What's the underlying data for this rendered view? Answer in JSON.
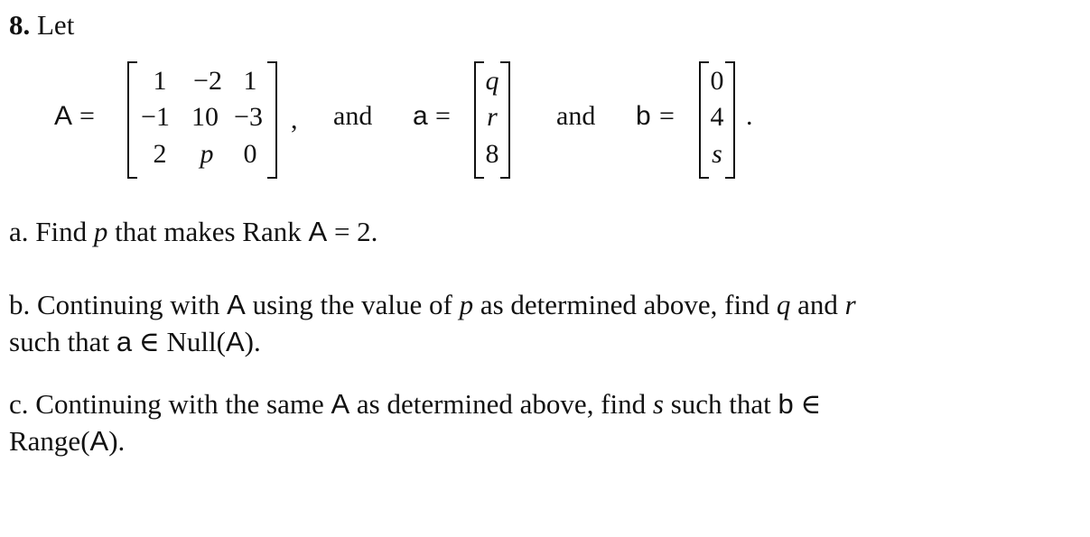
{
  "problem": {
    "number": "8.",
    "intro": "Let"
  },
  "definitions": {
    "matrix_A": {
      "name": "A",
      "equals": "=",
      "rows": [
        [
          "1",
          "−2",
          "1"
        ],
        [
          "−1",
          "10",
          "−3"
        ],
        [
          "2",
          "p",
          "0"
        ]
      ],
      "trailing": ","
    },
    "connector_1": "and",
    "vector_a": {
      "name": "a",
      "equals": "=",
      "entries": [
        "q",
        "r",
        "8"
      ]
    },
    "connector_2": "and",
    "vector_b": {
      "name": "b",
      "equals": "=",
      "entries": [
        "0",
        "4",
        "s"
      ],
      "trailing": "."
    }
  },
  "parts": {
    "a": {
      "label": "a.",
      "t1": "Find",
      "var_p": "p",
      "t2": "that makes Rank",
      "mat": "A",
      "t3": "= 2."
    },
    "b": {
      "label": "b.",
      "t1": "Continuing with",
      "mat": "A",
      "t2": "using the value of",
      "var_p": "p",
      "t3": "as determined above, find",
      "var_q": "q",
      "t4": "and",
      "var_r": "r",
      "line2_t1": "such that",
      "vec": "a",
      "line2_t2": "∈ Null(",
      "mat2": "A",
      "line2_t3": ")."
    },
    "c": {
      "label": "c.",
      "t1": "Continuing with the same",
      "mat": "A",
      "t2": "as determined above, find",
      "var_s": "s",
      "t3": "such that",
      "vec": "b",
      "t4": "∈",
      "line2_t1": "Range(",
      "mat2": "A",
      "line2_t2": ")."
    }
  }
}
